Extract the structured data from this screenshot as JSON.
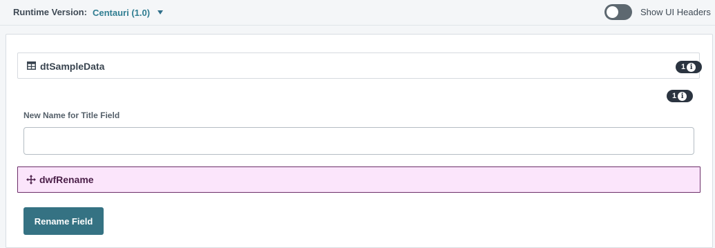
{
  "header": {
    "runtime_label": "Runtime Version:",
    "runtime_value": "Centauri (1.0)",
    "toggle_label": "Show UI Headers",
    "toggle_on": false
  },
  "datasource": {
    "icon": "table-icon",
    "title": "dtSampleData",
    "badge_count": "1",
    "badge_icon": "info-icon"
  },
  "field_block": {
    "badge_count": "1",
    "badge_icon": "info-icon",
    "label": "New Name for Title Field",
    "value": ""
  },
  "workflow": {
    "icon": "move-icon",
    "title": "dwfRename"
  },
  "action": {
    "button_label": "Rename Field"
  },
  "colors": {
    "accent": "#2f7d91",
    "button": "#357283",
    "workflow_bg": "#fbe5fb",
    "workflow_border": "#6b2d68",
    "badge": "#2b3440"
  }
}
